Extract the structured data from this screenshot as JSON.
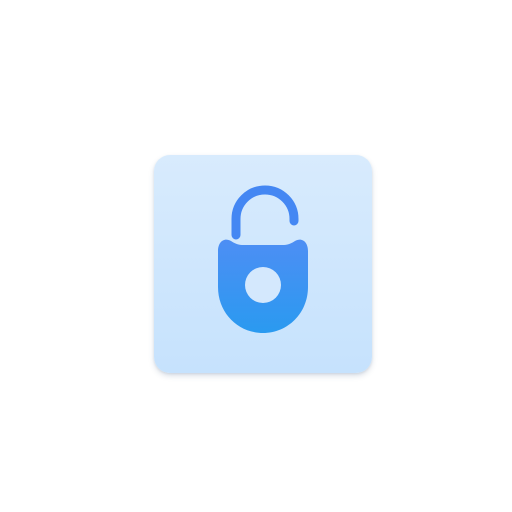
{
  "icon": {
    "name": "unlocked-padlock-app-icon",
    "glyph": "unlocked-padlock-icon",
    "colors": {
      "tile_top": "#d8ebfd",
      "tile_bottom": "#c6e2fd",
      "lock_top": "#4d8ef4",
      "lock_bottom": "#2a9af0",
      "keyhole": "#d4e8fd"
    }
  }
}
